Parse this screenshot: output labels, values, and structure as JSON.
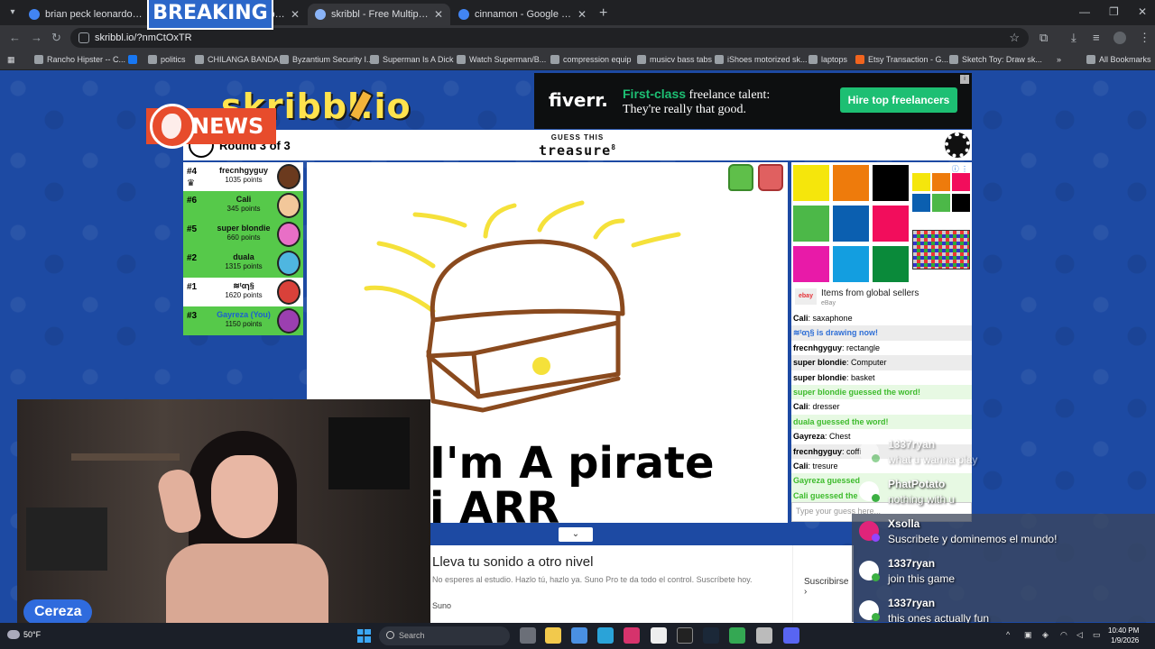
{
  "browser": {
    "tabs": [
      {
        "title": "brian peck leonardo dicaprio -",
        "color": "#4285f4"
      },
      {
        "title": "skribbl - Free Multiplayer Draw",
        "color": "#8ab4f8"
      },
      {
        "title": "skribbl - Free Multiplayer D",
        "color": "#8ab4f8",
        "active": true
      },
      {
        "title": "cinnamon - Google Search",
        "color": "#4285f4"
      }
    ],
    "url": "skribbl.io/?nmCtOxTR",
    "bookmarks": [
      {
        "label": "Rancho Hipster -- C...",
        "color": "#9aa0a6"
      },
      {
        "label": "",
        "color": "#1877f2"
      },
      {
        "label": "politics",
        "color": "#9aa0a6"
      },
      {
        "label": "CHILANGA BANDA",
        "color": "#9aa0a6"
      },
      {
        "label": "Byzantium Security I...",
        "color": "#9aa0a6"
      },
      {
        "label": "Superman Is A Dick",
        "color": "#9aa0a6"
      },
      {
        "label": "Watch Superman/B...",
        "color": "#9aa0a6"
      },
      {
        "label": "compression equip",
        "color": "#9aa0a6"
      },
      {
        "label": "musicv bass tabs",
        "color": "#9aa0a6"
      },
      {
        "label": "iShoes motorized sk...",
        "color": "#9aa0a6"
      },
      {
        "label": "laptops",
        "color": "#9aa0a6"
      },
      {
        "label": "Etsy Transaction - G...",
        "color": "#f1641e"
      },
      {
        "label": "Sketch Toy: Draw sk...",
        "color": "#9aa0a6"
      }
    ],
    "all_bookmarks": "All Bookmarks"
  },
  "overlay": {
    "breaking": "BREAKING",
    "news": "NEWS"
  },
  "logo": "skribbl.io",
  "ad_fiverr": {
    "brand": "fiverr.",
    "highlight": "First-class",
    "line1_rest": " freelance talent:",
    "line2": "They're really that good.",
    "cta": "Hire top freelancers"
  },
  "game": {
    "round": "Round 3 of 3",
    "guess_label": "GUESS THIS",
    "word": "treasure",
    "word_length": "8",
    "players": [
      {
        "rank": "#4",
        "name": "frecnhgyguy",
        "points": "1035 points",
        "bg": "#ffffff",
        "avatar": "#6b3a1e",
        "crown": true,
        "you": false
      },
      {
        "rank": "#6",
        "name": "Cali",
        "points": "345 points",
        "bg": "#56c94a",
        "avatar": "#f2c79a",
        "crown": false,
        "you": false
      },
      {
        "rank": "#5",
        "name": "super blondie",
        "points": "660 points",
        "bg": "#56c94a",
        "avatar": "#e86fc6",
        "crown": false,
        "you": false
      },
      {
        "rank": "#2",
        "name": "duala",
        "points": "1315 points",
        "bg": "#56c94a",
        "avatar": "#4fb6e0",
        "crown": false,
        "you": false
      },
      {
        "rank": "#1",
        "name": "≋ᵗαɿ§",
        "points": "1620 points",
        "bg": "#ffffff",
        "avatar": "#d9413a",
        "crown": false,
        "you": false
      },
      {
        "rank": "#3",
        "name": "Gayreza (You)",
        "points": "1150 points",
        "bg": "#56c94a",
        "avatar": "#9b3fb0",
        "crown": false,
        "you": true
      }
    ],
    "drawing_text_line1": "I'm A pirate",
    "drawing_text_line2": "i  ARR",
    "palette_big": [
      "#f5e60c",
      "#ee7b0c",
      "#000000",
      "#4cb848",
      "#0b5fb0",
      "#f20d5c",
      "#e81aa8",
      "#139ee0",
      "#0a8a3a"
    ],
    "palette_small": [
      "#f5e60c",
      "#ee7b0c",
      "#f20d5c",
      "#0b5fb0",
      "#4cb848",
      "#000000"
    ]
  },
  "ebay": {
    "logo": "ebay",
    "title": "Items from global sellers",
    "sub": "eBay"
  },
  "chat": [
    {
      "user": "Cali",
      "text": "saxaphone",
      "kind": "msg"
    },
    {
      "user": "",
      "text": "≋ᵗαɿ§ is drawing now!",
      "kind": "blue"
    },
    {
      "user": "frecnhgyguy",
      "text": "rectangle",
      "kind": "msg"
    },
    {
      "user": "super blondie",
      "text": "Computer",
      "kind": "msg"
    },
    {
      "user": "super blondie",
      "text": "basket",
      "kind": "msg"
    },
    {
      "user": "",
      "text": "super blondie guessed the word!",
      "kind": "green"
    },
    {
      "user": "Cali",
      "text": "dresser",
      "kind": "msg"
    },
    {
      "user": "",
      "text": "duala guessed the word!",
      "kind": "green"
    },
    {
      "user": "Gayreza",
      "text": "Chest",
      "kind": "msg"
    },
    {
      "user": "frecnhgyguy",
      "text": "coffi",
      "kind": "msg"
    },
    {
      "user": "Cali",
      "text": "tresure",
      "kind": "msg"
    },
    {
      "user": "",
      "text": "Gayreza guessed",
      "kind": "green"
    },
    {
      "user": "",
      "text": "Cali guessed the",
      "kind": "green"
    }
  ],
  "chat_placeholder": "Type your guess here...",
  "ad_suno": {
    "headline": "Lleva tu sonido a otro nivel",
    "desc": "No esperes al estudio. Hazlo tú, hazlo ya. Suno Pro te da todo el control. Suscríbete hoy.",
    "source": "Suno",
    "cta": "Suscribirse"
  },
  "streamer": "Cereza",
  "stream_chat": [
    {
      "user": "1337ryan",
      "text": "what u wanna play",
      "av": "#ffffff",
      "badge": "#3cb043",
      "faded": true
    },
    {
      "user": "PhatPotato",
      "text": "nothing with u",
      "av": "#ffffff",
      "badge": "#3cb043",
      "faded": false
    },
    {
      "user": "Xsolla",
      "text": "Suscribete y dominemos el mundo!",
      "av": "#e0247a",
      "badge": "#9146ff",
      "faded": false
    },
    {
      "user": "1337ryan",
      "text": "join this game",
      "av": "#ffffff",
      "badge": "#3cb043",
      "faded": false
    },
    {
      "user": "1337ryan",
      "text": "this ones actually fun",
      "av": "#ffffff",
      "badge": "#3cb043",
      "faded": false
    }
  ],
  "taskbar": {
    "temp": "50°F",
    "search": "Search",
    "time": "10:40 PM",
    "date": "1/9/2026"
  }
}
